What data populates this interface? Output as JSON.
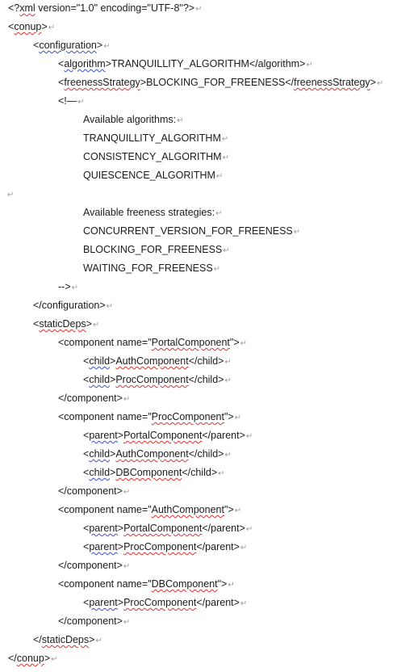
{
  "pilcrow": "↵",
  "lines": [
    {
      "indent": 0,
      "spans": [
        {
          "t": "<?"
        },
        {
          "t": "xml",
          "s": "sq"
        },
        {
          "t": " version=\"1.0\" encoding=\"UTF-8\"?>"
        }
      ]
    },
    {
      "indent": 0,
      "spans": [
        {
          "t": "<"
        },
        {
          "t": "conup",
          "s": "sq"
        },
        {
          "t": ">"
        }
      ]
    },
    {
      "indent": 1,
      "spans": [
        {
          "t": "<"
        },
        {
          "t": "configuration",
          "s": "sqb"
        },
        {
          "t": ">"
        }
      ]
    },
    {
      "indent": 2,
      "spans": [
        {
          "t": "<"
        },
        {
          "t": "algorithm",
          "s": "sqb"
        },
        {
          "t": ">TRANQUILLITY_ALGORITHM</algorithm>"
        }
      ]
    },
    {
      "indent": 2,
      "spans": [
        {
          "t": "<"
        },
        {
          "t": "freenessStrategy",
          "s": "sq"
        },
        {
          "t": ">BLOCKING_FOR_FREENESS</"
        },
        {
          "t": "freenessStrategy",
          "s": "sq"
        },
        {
          "t": ">"
        }
      ]
    },
    {
      "indent": 2,
      "spans": [
        {
          "t": "<!—"
        }
      ]
    },
    {
      "indent": 3,
      "spans": [
        {
          "t": "Available algorithms:"
        }
      ]
    },
    {
      "indent": 3,
      "spans": [
        {
          "t": "TRANQUILLITY_ALGORITHM"
        }
      ]
    },
    {
      "indent": 3,
      "spans": [
        {
          "t": "CONSISTENCY_ALGORITHM"
        }
      ]
    },
    {
      "indent": 3,
      "spans": [
        {
          "t": "QUIESCENCE_ALGORITHM"
        }
      ]
    },
    {
      "indent": 0,
      "spans": [
        {
          "t": ""
        }
      ]
    },
    {
      "indent": 3,
      "spans": [
        {
          "t": "Available freeness strategies:"
        }
      ]
    },
    {
      "indent": 3,
      "spans": [
        {
          "t": "CONCURRENT_VERSION_FOR_FREENESS"
        }
      ]
    },
    {
      "indent": 3,
      "spans": [
        {
          "t": "BLOCKING_FOR_FREENESS"
        }
      ]
    },
    {
      "indent": 3,
      "spans": [
        {
          "t": "WAITING_FOR_FREENESS"
        }
      ]
    },
    {
      "indent": 2,
      "spans": [
        {
          "t": "-->"
        }
      ]
    },
    {
      "indent": 1,
      "spans": [
        {
          "t": "</configuration>"
        }
      ]
    },
    {
      "indent": 1,
      "spans": [
        {
          "t": "<"
        },
        {
          "t": "staticDeps",
          "s": "sq"
        },
        {
          "t": ">"
        }
      ]
    },
    {
      "indent": 2,
      "spans": [
        {
          "t": "<component name=\""
        },
        {
          "t": "PortalComponent",
          "s": "sq"
        },
        {
          "t": "\">"
        }
      ]
    },
    {
      "indent": 3,
      "spans": [
        {
          "t": "<"
        },
        {
          "t": "child",
          "s": "sqb"
        },
        {
          "t": ">"
        },
        {
          "t": "AuthComponent",
          "s": "sq"
        },
        {
          "t": "</child>"
        }
      ]
    },
    {
      "indent": 3,
      "spans": [
        {
          "t": "<"
        },
        {
          "t": "child",
          "s": "sqb"
        },
        {
          "t": ">"
        },
        {
          "t": "ProcComponent",
          "s": "sq"
        },
        {
          "t": "</child>"
        }
      ]
    },
    {
      "indent": 2,
      "spans": [
        {
          "t": "</component>"
        }
      ]
    },
    {
      "indent": 2,
      "spans": [
        {
          "t": "<component name=\""
        },
        {
          "t": "ProcComponent",
          "s": "sq"
        },
        {
          "t": "\">"
        }
      ]
    },
    {
      "indent": 3,
      "spans": [
        {
          "t": "<"
        },
        {
          "t": "parent",
          "s": "sqb"
        },
        {
          "t": ">"
        },
        {
          "t": "PortalComponent",
          "s": "sq"
        },
        {
          "t": "</parent>"
        }
      ]
    },
    {
      "indent": 3,
      "spans": [
        {
          "t": "<"
        },
        {
          "t": "child",
          "s": "sqb"
        },
        {
          "t": ">"
        },
        {
          "t": "AuthComponent",
          "s": "sq"
        },
        {
          "t": "</child>"
        }
      ]
    },
    {
      "indent": 3,
      "spans": [
        {
          "t": "<"
        },
        {
          "t": "child",
          "s": "sqb"
        },
        {
          "t": ">"
        },
        {
          "t": "DBComponent",
          "s": "sq"
        },
        {
          "t": "</child>"
        }
      ]
    },
    {
      "indent": 2,
      "spans": [
        {
          "t": "</component>"
        }
      ]
    },
    {
      "indent": 2,
      "spans": [
        {
          "t": "<component name=\""
        },
        {
          "t": "AuthComponent",
          "s": "sq"
        },
        {
          "t": "\">"
        }
      ]
    },
    {
      "indent": 3,
      "spans": [
        {
          "t": "<"
        },
        {
          "t": "parent",
          "s": "sqb"
        },
        {
          "t": ">"
        },
        {
          "t": "PortalComponent",
          "s": "sq"
        },
        {
          "t": "</parent>"
        }
      ]
    },
    {
      "indent": 3,
      "spans": [
        {
          "t": "<"
        },
        {
          "t": "parent",
          "s": "sqb"
        },
        {
          "t": ">"
        },
        {
          "t": "ProcComponent",
          "s": "sq"
        },
        {
          "t": "</parent>"
        }
      ]
    },
    {
      "indent": 2,
      "spans": [
        {
          "t": "</component>"
        }
      ]
    },
    {
      "indent": 2,
      "spans": [
        {
          "t": "<component name=\""
        },
        {
          "t": "DBComponent",
          "s": "sq"
        },
        {
          "t": "\">"
        }
      ]
    },
    {
      "indent": 3,
      "spans": [
        {
          "t": "<"
        },
        {
          "t": "parent",
          "s": "sqb"
        },
        {
          "t": ">"
        },
        {
          "t": "ProcComponent",
          "s": "sq"
        },
        {
          "t": "</parent>"
        }
      ]
    },
    {
      "indent": 2,
      "spans": [
        {
          "t": "</component>"
        }
      ]
    },
    {
      "indent": 1,
      "spans": [
        {
          "t": "</"
        },
        {
          "t": "staticDeps",
          "s": "sq"
        },
        {
          "t": ">"
        }
      ]
    },
    {
      "indent": 0,
      "spans": [
        {
          "t": "</"
        },
        {
          "t": "conup",
          "s": "sq"
        },
        {
          "t": ">"
        }
      ]
    }
  ]
}
